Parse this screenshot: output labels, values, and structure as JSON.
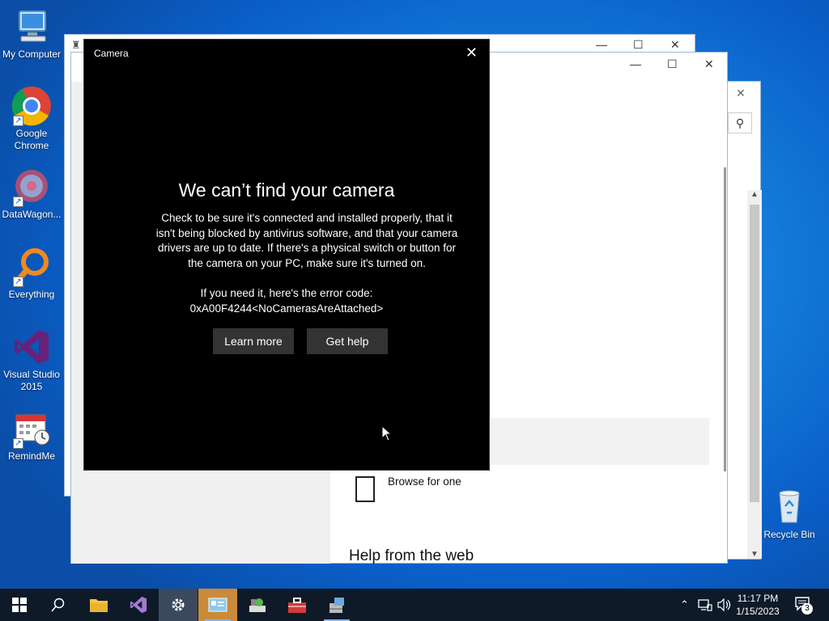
{
  "desktop": {
    "icons": [
      {
        "label": "My Computer",
        "icon": "computer-icon"
      },
      {
        "label": "Google Chrome",
        "icon": "chrome-icon"
      },
      {
        "label": "DataWagon...",
        "icon": "datawagon-icon"
      },
      {
        "label": "Everything",
        "icon": "everything-search-icon"
      },
      {
        "label": "Visual Studio 2015",
        "icon": "visual-studio-icon"
      },
      {
        "label": "RemindMe",
        "icon": "calendar-clock-icon"
      },
      {
        "label": "Recycle Bin",
        "icon": "recycle-bin-icon"
      }
    ]
  },
  "background_window": {
    "browse_label": "Browse for one",
    "help_heading": "Help from the web"
  },
  "camera_dialog": {
    "title": "Camera",
    "close_glyph": "✕",
    "heading": "We can’t find your camera",
    "body": "Check to be sure it's connected and installed properly, that it isn't being blocked by antivirus software, and that your camera drivers are up to date. If there's a physical switch or button for the camera on your PC, make sure it's turned on.",
    "error_intro": "If you need it, here's the error code:",
    "error_code": "0xA00F4244<NoCamerasAreAttached>",
    "learn_more": "Learn more",
    "get_help": "Get help"
  },
  "taskbar": {
    "time": "11:17 PM",
    "date": "1/15/2023",
    "notification_count": "3",
    "items": [
      "start-icon",
      "search-icon",
      "file-explorer-icon",
      "visual-studio-icon",
      "settings-icon",
      "control-panel-icon",
      "network-tool-icon",
      "toolbox-icon",
      "installer-icon"
    ]
  },
  "colors": {
    "dialog_bg": "#000000",
    "button_bg": "#333333",
    "taskbar_bg": "#0e1a28",
    "desktop_blue": "#137bd8"
  }
}
